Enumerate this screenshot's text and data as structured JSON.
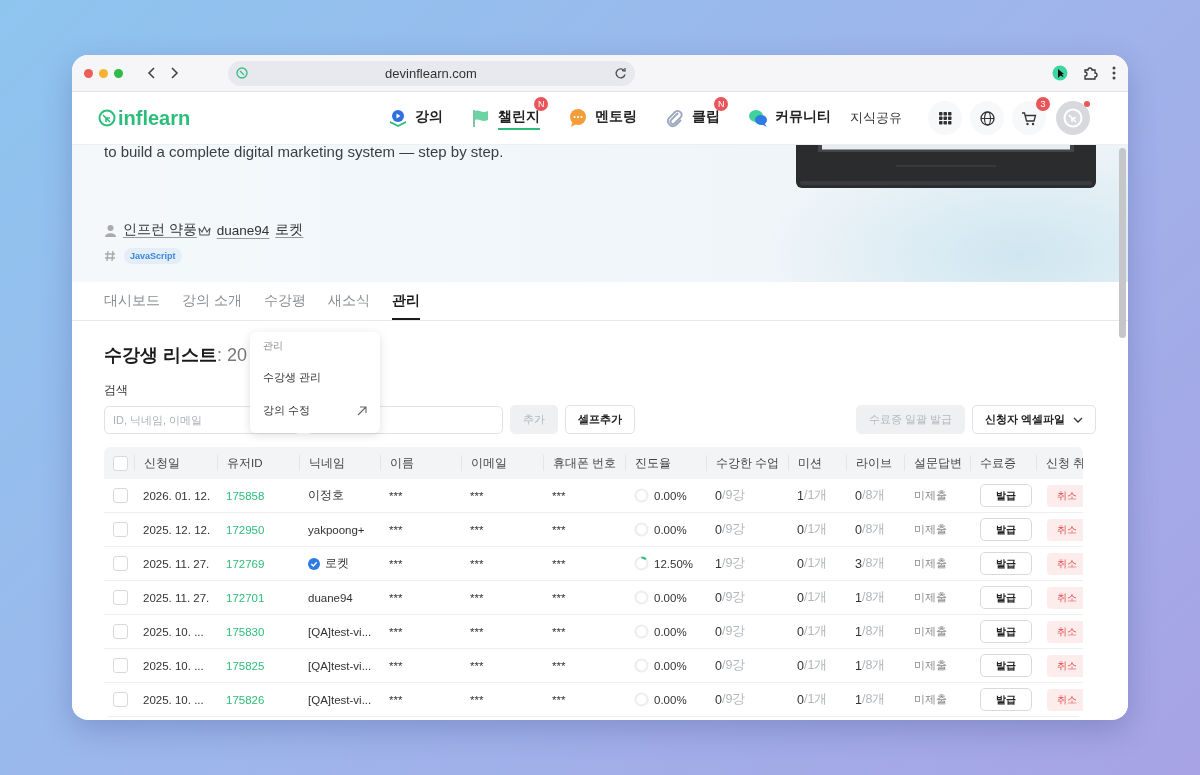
{
  "browser": {
    "url": "devinflearn.com"
  },
  "header": {
    "logo": "inflearn",
    "nav": [
      {
        "label": "강의",
        "kind": "lecture",
        "selected": false
      },
      {
        "label": "챌린지",
        "kind": "challenge",
        "selected": true,
        "badge": "N"
      },
      {
        "label": "멘토링",
        "kind": "mentoring",
        "selected": false
      },
      {
        "label": "클립",
        "kind": "clip",
        "selected": false,
        "badge": "N"
      },
      {
        "label": "커뮤니티",
        "kind": "community",
        "selected": false
      }
    ],
    "knowledge_share": "지식공유",
    "cart_badge": "3"
  },
  "hero": {
    "description": "to build a complete digital marketing system — step by step.",
    "authors": [
      {
        "name": "인프런 약풍",
        "crown": true
      },
      {
        "name": "duane94",
        "crown": false
      },
      {
        "name": "로켓",
        "crown": false
      }
    ],
    "tags": [
      "JavaScript"
    ]
  },
  "tabs": [
    {
      "label": "대시보드",
      "selected": false
    },
    {
      "label": "강의 소개",
      "selected": false
    },
    {
      "label": "수강평",
      "selected": false
    },
    {
      "label": "새소식",
      "selected": false
    },
    {
      "label": "관리",
      "selected": true
    }
  ],
  "menu": {
    "header": "관리",
    "items": [
      {
        "label": "수강생 관리",
        "external": false
      },
      {
        "label": "강의 수정",
        "external": true
      }
    ]
  },
  "list": {
    "title": "수강생 리스트",
    "count": ": 20",
    "search_label": "검색",
    "search_placeholder": "ID, 닉네임, 이메일",
    "left_buttons": [
      {
        "label": "추가",
        "disabled": true
      },
      {
        "label": "셀프추가",
        "disabled": false
      }
    ],
    "right_buttons": [
      {
        "label": "수료증 일괄 발급",
        "disabled": true,
        "dropdown": false
      },
      {
        "label": "신청자 엑셀파일",
        "disabled": false,
        "dropdown": true
      }
    ]
  },
  "table": {
    "all_checked": false,
    "columns": [
      "신청일",
      "유저ID",
      "닉네임",
      "이름",
      "이메일",
      "휴대폰 번호",
      "진도율",
      "수강한 수업",
      "미션",
      "라이브",
      "설문답변",
      "수료증",
      "신청 취"
    ],
    "rows": [
      {
        "checked": false,
        "date": "2026. 01. 12.",
        "user_id": "175858",
        "nickname": "이정호",
        "verified": false,
        "name": "***",
        "email": "***",
        "phone": "***",
        "progress": "0.00%",
        "level": 0,
        "lessons_done": "0",
        "lessons_total": "/9강",
        "missions_done": "1",
        "missions_total": "/1개",
        "live_done": "0",
        "live_total": "/8개",
        "survey": "미제출",
        "certificate": "발급",
        "cancel": "취소"
      },
      {
        "checked": false,
        "date": "2025. 12. 12.",
        "user_id": "172950",
        "nickname": "yakpoong+",
        "verified": false,
        "name": "***",
        "email": "***",
        "phone": "***",
        "progress": "0.00%",
        "level": 0,
        "lessons_done": "0",
        "lessons_total": "/9강",
        "missions_done": "0",
        "missions_total": "/1개",
        "live_done": "0",
        "live_total": "/8개",
        "survey": "미제출",
        "certificate": "발급",
        "cancel": "취소"
      },
      {
        "checked": false,
        "date": "2025. 11. 27.",
        "user_id": "172769",
        "nickname": "로켓",
        "verified": true,
        "name": "***",
        "email": "***",
        "phone": "***",
        "progress": "12.50%",
        "level": 0.125,
        "lessons_done": "1",
        "lessons_total": "/9강",
        "missions_done": "0",
        "missions_total": "/1개",
        "live_done": "3",
        "live_total": "/8개",
        "survey": "미제출",
        "certificate": "발급",
        "cancel": "취소"
      },
      {
        "checked": false,
        "date": "2025. 11. 27.",
        "user_id": "172701",
        "nickname": "duane94",
        "verified": false,
        "name": "***",
        "email": "***",
        "phone": "***",
        "progress": "0.00%",
        "level": 0,
        "lessons_done": "0",
        "lessons_total": "/9강",
        "missions_done": "0",
        "missions_total": "/1개",
        "live_done": "1",
        "live_total": "/8개",
        "survey": "미제출",
        "certificate": "발급",
        "cancel": "취소"
      },
      {
        "checked": false,
        "date": "2025. 10. ...",
        "user_id": "175830",
        "nickname": "[QA]test-vi...",
        "verified": false,
        "name": "***",
        "email": "***",
        "phone": "***",
        "progress": "0.00%",
        "level": 0,
        "lessons_done": "0",
        "lessons_total": "/9강",
        "missions_done": "0",
        "missions_total": "/1개",
        "live_done": "1",
        "live_total": "/8개",
        "survey": "미제출",
        "certificate": "발급",
        "cancel": "취소"
      },
      {
        "checked": false,
        "date": "2025. 10. ...",
        "user_id": "175825",
        "nickname": "[QA]test-vi...",
        "verified": false,
        "name": "***",
        "email": "***",
        "phone": "***",
        "progress": "0.00%",
        "level": 0,
        "lessons_done": "0",
        "lessons_total": "/9강",
        "missions_done": "0",
        "missions_total": "/1개",
        "live_done": "1",
        "live_total": "/8개",
        "survey": "미제출",
        "certificate": "발급",
        "cancel": "취소"
      },
      {
        "checked": false,
        "date": "2025. 10. ...",
        "user_id": "175826",
        "nickname": "[QA]test-vi...",
        "verified": false,
        "name": "***",
        "email": "***",
        "phone": "***",
        "progress": "0.00%",
        "level": 0,
        "lessons_done": "0",
        "lessons_total": "/9강",
        "missions_done": "0",
        "missions_total": "/1개",
        "live_done": "1",
        "live_total": "/8개",
        "survey": "미제출",
        "certificate": "발급",
        "cancel": "취소"
      }
    ]
  }
}
